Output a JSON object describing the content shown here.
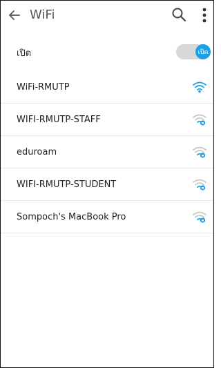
{
  "appbar": {
    "title": "WiFi",
    "back_icon": "arrow-left-icon",
    "search_icon": "search-icon",
    "more_icon": "more-vertical-icon"
  },
  "toggle": {
    "label": "เปิด",
    "state_text": "เปิด",
    "on": true
  },
  "networks": [
    {
      "ssid": "WiFi-RMUTP",
      "secured": false,
      "icon": "wifi-open-icon"
    },
    {
      "ssid": "WIFI-RMUTP-STAFF",
      "secured": true,
      "icon": "wifi-locked-icon"
    },
    {
      "ssid": "eduroam",
      "secured": true,
      "icon": "wifi-locked-icon"
    },
    {
      "ssid": "WIFI-RMUTP-STUDENT",
      "secured": true,
      "icon": "wifi-locked-icon"
    },
    {
      "ssid": "Sompoch's MacBook Pro",
      "secured": true,
      "icon": "wifi-locked-icon"
    }
  ],
  "colors": {
    "accent": "#1aa0e8",
    "wifi_gray": "#c8c8c8",
    "divider": "#e9e9e9"
  }
}
